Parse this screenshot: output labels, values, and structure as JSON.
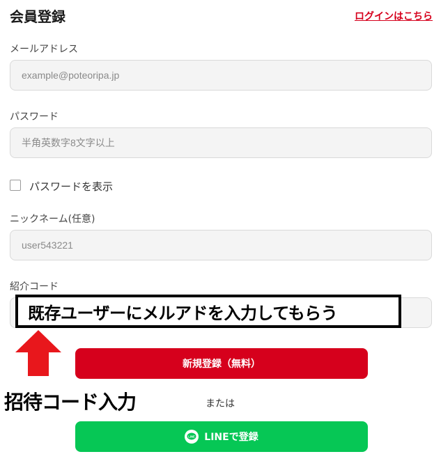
{
  "colors": {
    "brand_red": "#d6001c",
    "line_green": "#06c755",
    "field_bg": "#f4f4f4"
  },
  "header": {
    "title": "会員登録",
    "login_link": "ログインはこちら"
  },
  "form": {
    "email": {
      "label": "メールアドレス",
      "placeholder": "example@poteoripa.jp"
    },
    "password": {
      "label": "パスワード",
      "placeholder": "半角英数字8文字以上"
    },
    "show_password": {
      "label": "パスワードを表示",
      "checked": false
    },
    "nickname": {
      "label": "ニックネーム(任意)",
      "placeholder": "user543221"
    },
    "referral": {
      "label": "紹介コード",
      "placeholder": ""
    }
  },
  "buttons": {
    "register": "新規登録（無料）",
    "or_text": "または",
    "line_register": "LINEで登録"
  },
  "annotations": {
    "box_text": "既存ユーザーにメルアドを入力してもらう",
    "invite_text": "招待コード入力",
    "arrow_icon": "red-up-arrow-icon",
    "line_icon_text": "LINE"
  }
}
